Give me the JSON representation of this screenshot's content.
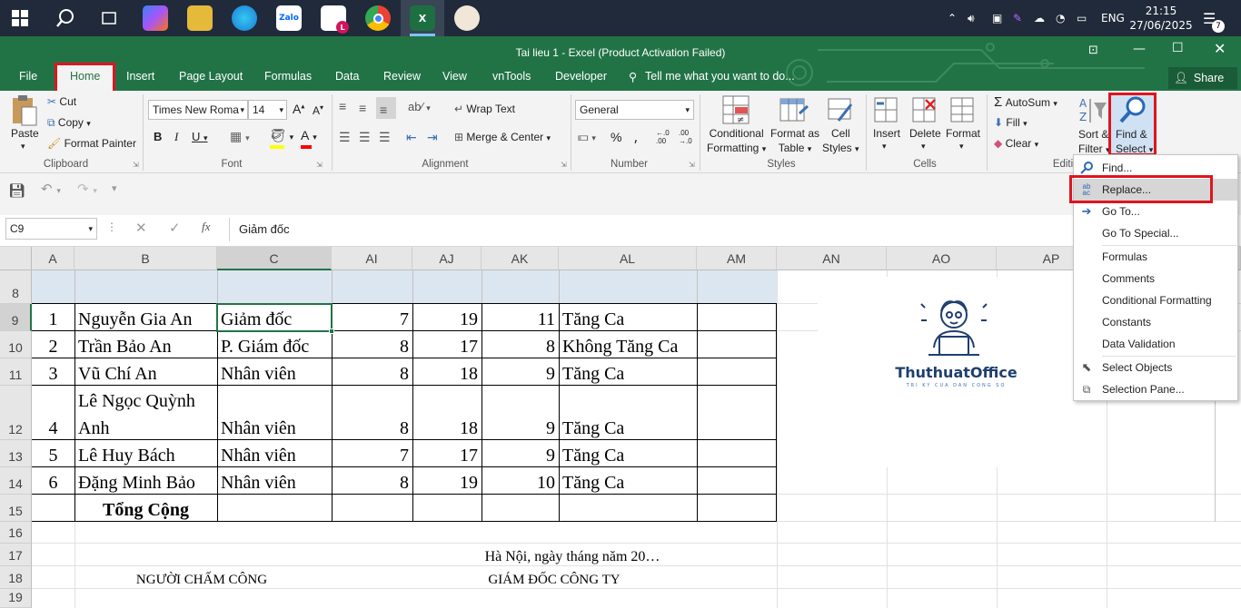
{
  "taskbar": {
    "time": "21:15",
    "date": "27/06/2025",
    "language": "ENG",
    "notification_count": "7",
    "zalo_label": "Zalo"
  },
  "window": {
    "title": "Tai lieu 1  -  Excel (Product Activation Failed)"
  },
  "tabs": [
    "File",
    "Home",
    "Insert",
    "Page Layout",
    "Formulas",
    "Data",
    "Review",
    "View",
    "vnTools",
    "Developer"
  ],
  "tell_me": "Tell me what you want to do...",
  "share": "Share",
  "ribbon": {
    "clipboard": {
      "paste": "Paste",
      "cut": "Cut",
      "copy": "Copy",
      "format_painter": "Format Painter",
      "group": "Clipboard"
    },
    "font": {
      "name": "Times New Roma",
      "size": "14",
      "group": "Font"
    },
    "alignment": {
      "wrap": "Wrap Text",
      "merge": "Merge & Center",
      "group": "Alignment"
    },
    "number": {
      "format": "General",
      "group": "Number"
    },
    "styles": {
      "cond1": "Conditional",
      "cond2": "Formatting",
      "fat1": "Format as",
      "fat2": "Table",
      "cs1": "Cell",
      "cs2": "Styles",
      "group": "Styles"
    },
    "cells": {
      "insert": "Insert",
      "delete": "Delete",
      "format": "Format",
      "group": "Cells"
    },
    "editing": {
      "autosum": "AutoSum",
      "fill": "Fill",
      "clear": "Clear",
      "sort1": "Sort &",
      "sort2": "Filter",
      "find1": "Find &",
      "find2": "Select",
      "group": "Editi"
    }
  },
  "formula_bar": {
    "name_box": "C9",
    "content": "Giảm đốc"
  },
  "columns": [
    "A",
    "B",
    "C",
    "AI",
    "AJ",
    "AK",
    "AL",
    "AM",
    "AN",
    "AO",
    "AP"
  ],
  "row_numbers": [
    "8",
    "9",
    "10",
    "11",
    "12",
    "13",
    "14",
    "15",
    "16",
    "17",
    "18",
    "19"
  ],
  "rows": [
    {
      "no": "1",
      "name": "Nguyễn Gia An",
      "pos": "Giảm đốc",
      "ai": "7",
      "aj": "19",
      "ak": "11",
      "al": "Tăng Ca"
    },
    {
      "no": "2",
      "name": "Trần Bảo An",
      "pos": "P. Giám đốc",
      "ai": "8",
      "aj": "17",
      "ak": "8",
      "al": "Không Tăng Ca"
    },
    {
      "no": "3",
      "name": "Vũ Chí An",
      "pos": "Nhân viên",
      "ai": "8",
      "aj": "18",
      "ak": "9",
      "al": "Tăng Ca"
    },
    {
      "no": "4",
      "name1": "Lê Ngọc Quỳnh",
      "name2": "Anh",
      "pos": "Nhân viên",
      "ai": "8",
      "aj": "18",
      "ak": "9",
      "al": "Tăng Ca"
    },
    {
      "no": "5",
      "name": "Lê Huy Bách",
      "pos": "Nhân viên",
      "ai": "7",
      "aj": "17",
      "ak": "9",
      "al": "Tăng Ca"
    },
    {
      "no": "6",
      "name": "Đặng Minh Bảo",
      "pos": "Nhân viên",
      "ai": "8",
      "aj": "19",
      "ak": "10",
      "al": "Tăng Ca"
    }
  ],
  "total_label": "Tổng Cộng",
  "footer": {
    "place_date": "Hà Nội, ngày          tháng          năm 20…",
    "timekeeper": "NGƯỜI CHẤM CÔNG",
    "director": "GIÁM ĐỐC CÔNG TY"
  },
  "logo": {
    "name": "ThuthuatOffice",
    "tagline": "TRI KY CUA DAN CONG SO"
  },
  "menu": [
    "Find...",
    "Replace...",
    "Go To...",
    "Go To Special...",
    "Formulas",
    "Comments",
    "Conditional Formatting",
    "Constants",
    "Data Validation",
    "Select Objects",
    "Selection Pane..."
  ],
  "colors": {
    "excel_green": "#217346",
    "highlight_red": "#e0141e",
    "header_blue": "#dce6f1"
  }
}
